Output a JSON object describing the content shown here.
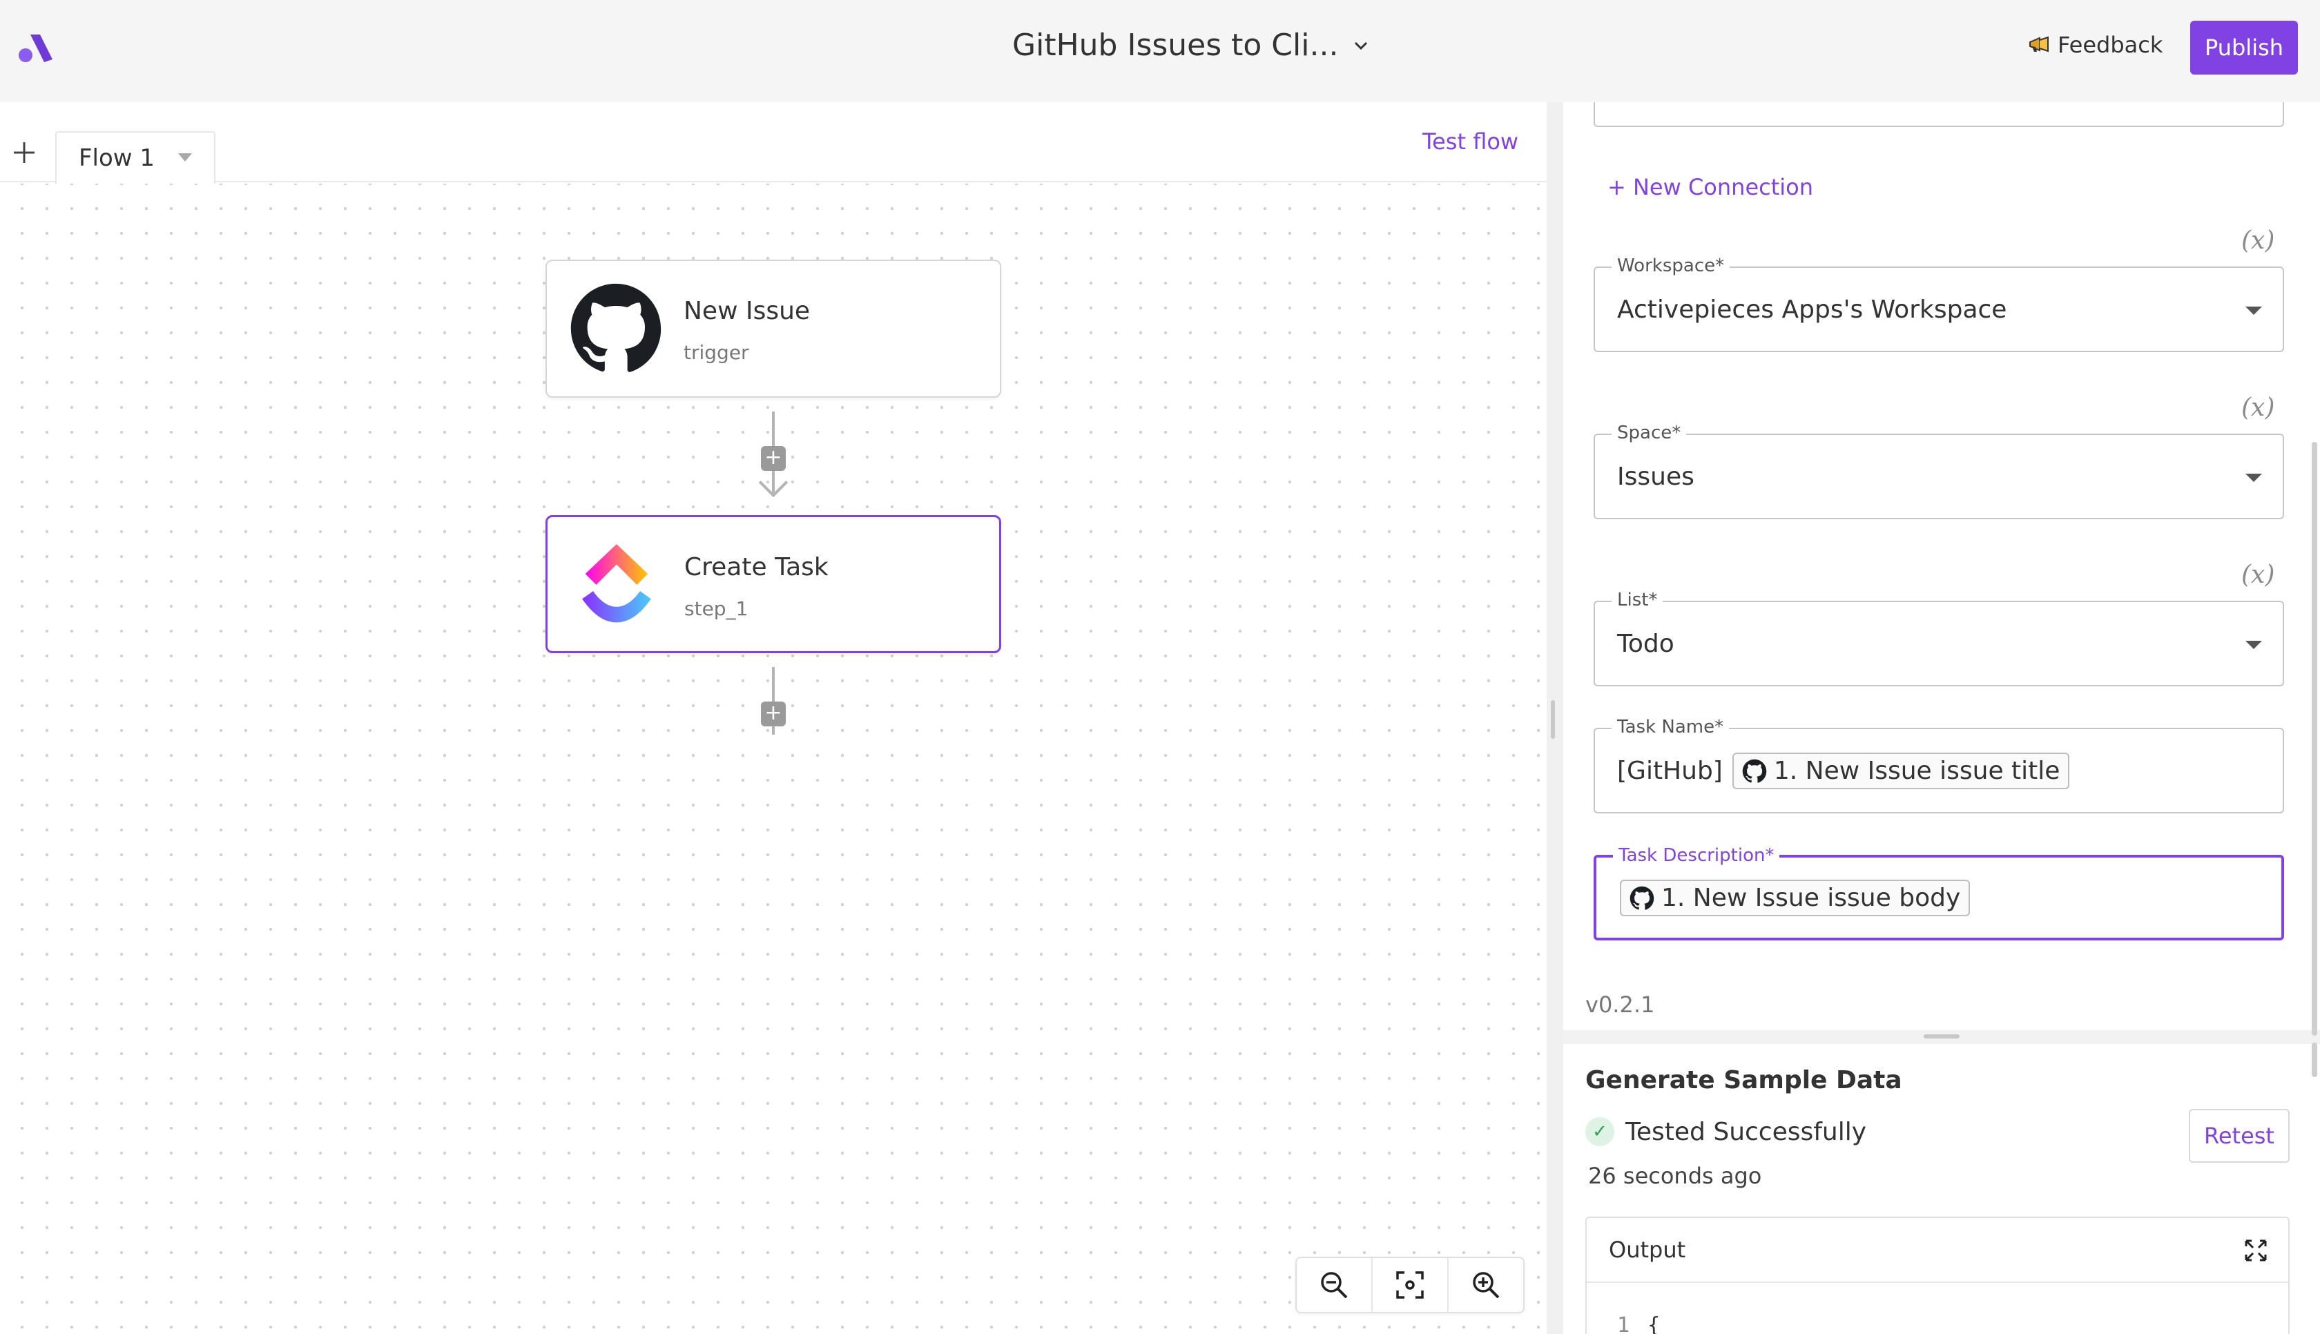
{
  "header": {
    "flow_name": "GitHub Issues to Cli...",
    "feedback_label": "Feedback",
    "publish_label": "Publish"
  },
  "tabs": {
    "items": [
      {
        "label": "Flow 1"
      }
    ],
    "test_flow_label": "Test flow"
  },
  "canvas": {
    "nodes": [
      {
        "title": "New Issue",
        "subtitle": "trigger",
        "icon": "github-icon"
      },
      {
        "title": "Create Task",
        "subtitle": "step_1",
        "icon": "clickup-icon"
      }
    ]
  },
  "panel": {
    "new_connection_label": "+ New Connection",
    "fx_label": "(x)",
    "fields": {
      "workspace": {
        "label": "Workspace*",
        "value": "Activepieces Apps's Workspace"
      },
      "space": {
        "label": "Space*",
        "value": "Issues"
      },
      "list": {
        "label": "List*",
        "value": "Todo"
      },
      "task_name": {
        "label": "Task Name*",
        "prefix": "[GitHub]",
        "chip": "1. New Issue issue title"
      },
      "task_description": {
        "label": "Task Description*",
        "chip": "1. New Issue issue body"
      }
    },
    "version": "v0.2.1",
    "sample": {
      "title": "Generate Sample Data",
      "status": "Tested Successfully",
      "time_ago": "26 seconds ago",
      "retest_label": "Retest",
      "output_label": "Output",
      "code_line_number": "1",
      "code_first_char": "{"
    }
  },
  "colors": {
    "accent": "#8142e3",
    "success": "#2f9e52"
  }
}
